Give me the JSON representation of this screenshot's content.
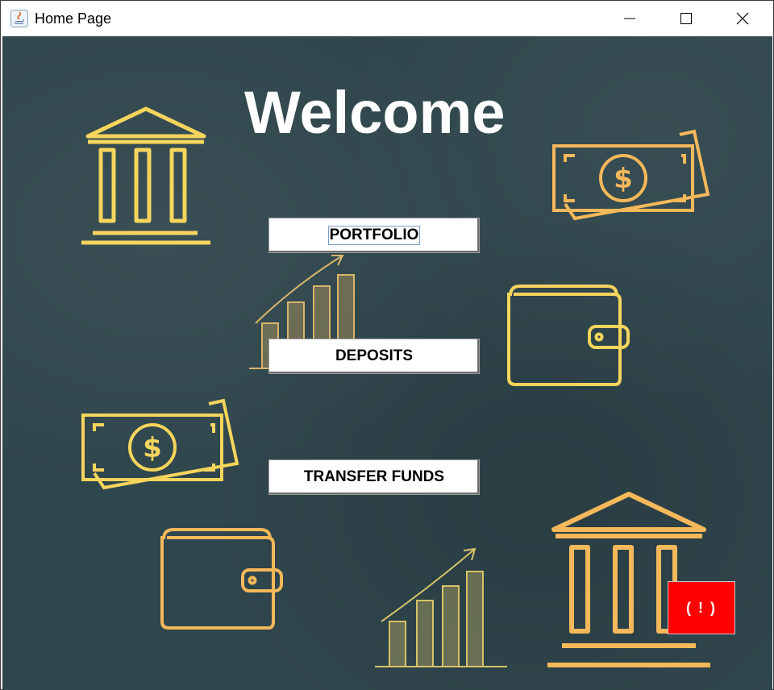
{
  "window": {
    "title": "Home Page",
    "app_icon": "java-icon",
    "controls": [
      "minimize-icon",
      "maximize-icon",
      "close-icon"
    ]
  },
  "main": {
    "heading": "Welcome",
    "buttons": {
      "portfolio": "PORTFOLIO",
      "deposits": "DEPOSITS",
      "transfer": "TRANSFER FUNDS"
    },
    "alert_label": "( ! )"
  },
  "colors": {
    "background": "#2f464c",
    "icon_yellow": "#f6d55c",
    "icon_orange": "#f5b85a",
    "alert": "#ff0000"
  },
  "decorations": [
    "bank-icon",
    "money-bill-icon",
    "growth-chart-icon",
    "wallet-icon"
  ]
}
